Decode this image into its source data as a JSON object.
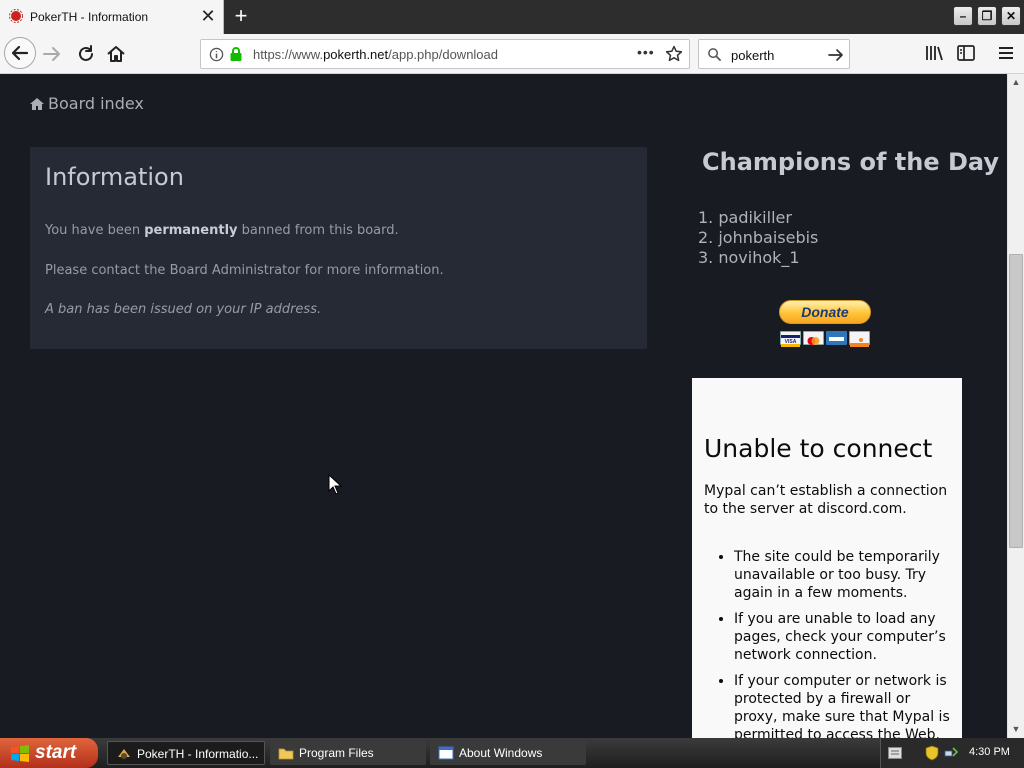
{
  "browser": {
    "tab_title": "PokerTH - Information",
    "url_prefix": "https://www.",
    "url_domain": "pokerth.net",
    "url_path": "/app.php/download",
    "search_value": "pokerth"
  },
  "page": {
    "breadcrumb": "Board index",
    "info": {
      "title": "Information",
      "line1_start": "You have been ",
      "line1_bold": "permanently",
      "line1_end": " banned from this board.",
      "line2": "Please contact the Board Administrator for more information.",
      "line3": "A ban has been issued on your IP address."
    },
    "champions": {
      "title": "Champions of the Day",
      "entries": [
        "1. padikiller",
        "2. johnbaisebis",
        "3. novihok_1"
      ]
    },
    "donate_label": "Donate",
    "discord_error": {
      "title": "Unable to connect",
      "description": "Mypal can’t establish a connection to the server at discord.com.",
      "tips": [
        "The site could be temporarily unavailable or too busy. Try again in a few moments.",
        "If you are unable to load any pages, check your computer’s network connection.",
        "If your computer or network is protected by a firewall or proxy, make sure that Mypal is permitted to access the Web."
      ]
    }
  },
  "taskbar": {
    "start_label": "start",
    "tasks": [
      "PokerTH - Informatio...",
      "Program Files",
      "About Windows"
    ],
    "clock": "4:30 PM"
  }
}
